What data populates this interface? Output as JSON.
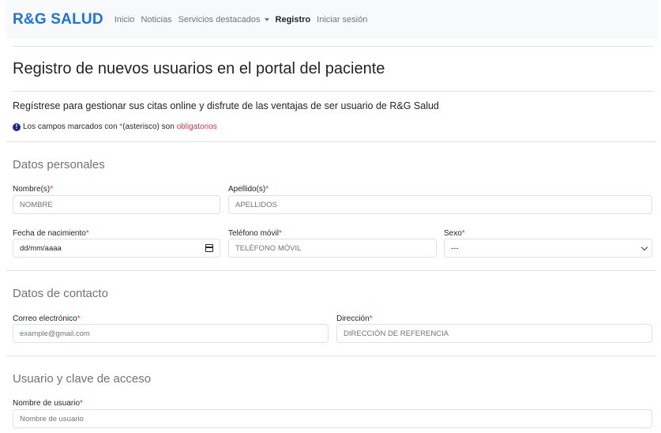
{
  "navbar": {
    "brand": "R&G SALUD",
    "links": [
      {
        "label": "Inicio",
        "active": false
      },
      {
        "label": "Noticias",
        "active": false
      },
      {
        "label": "Servicios destacados",
        "active": false,
        "dropdown": true
      },
      {
        "label": "Registro",
        "active": true
      },
      {
        "label": "Iniciar sesión",
        "active": false
      }
    ]
  },
  "page": {
    "title": "Registro de nuevos usuarios en el portal del paciente",
    "lead": "Regístrese para gestionar sus citas online y disfrute de las ventajas de ser usuario de R&G Salud",
    "note_prefix": "Los campos marcados con ",
    "note_asterisk": "*",
    "note_middle": "(asterisco) son ",
    "note_required": "obligatorios",
    "note_icon": "!"
  },
  "sections": {
    "personal": {
      "title": "Datos personales",
      "nombre": {
        "label": "Nombre(s)",
        "placeholder": "NOMBRE"
      },
      "apellidos": {
        "label": "Apellido(s)",
        "placeholder": "APELLIDOS"
      },
      "fecha": {
        "label": "Fecha de nacimiento",
        "value": "dd/mm/aaaa"
      },
      "telefono": {
        "label": "Teléfono móvil",
        "placeholder": "TELÉFONO MÓVIL"
      },
      "sexo": {
        "label": "Sexo",
        "value": "---"
      }
    },
    "contact": {
      "title": "Datos de contacto",
      "correo": {
        "label": "Correo electrónico",
        "placeholder": "example@gmail.com"
      },
      "direccion": {
        "label": "Dirección",
        "placeholder": "DIRECCIÓN DE REFERENCIA"
      }
    },
    "account": {
      "title": "Usuario y clave de acceso",
      "usuario": {
        "label": "Nombre de usuario",
        "placeholder": "Nombre de usuario"
      }
    }
  },
  "required_mark": "*",
  "colors": {
    "brand": "#1a73e8",
    "required": "#dc3545",
    "navbar_bg": "#f8f9fa",
    "section_title": "#6c757d"
  }
}
